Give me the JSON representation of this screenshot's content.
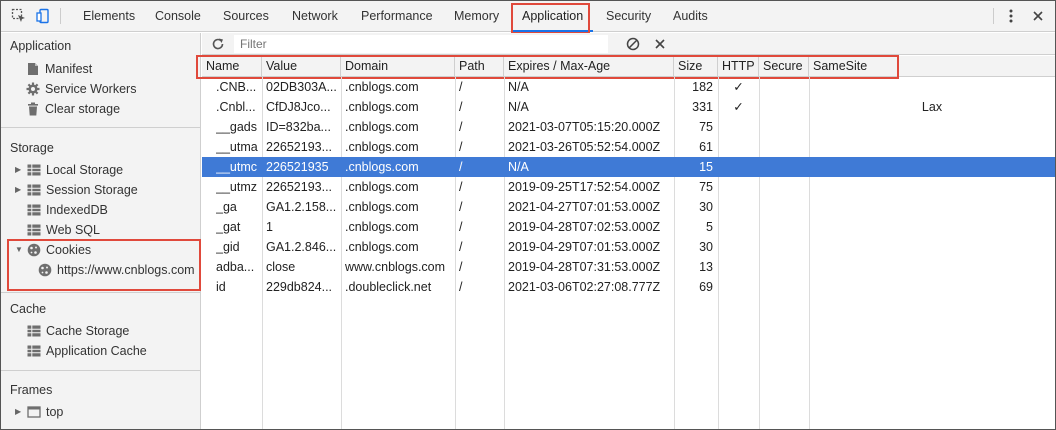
{
  "toolbar": {
    "tabs": [
      "Elements",
      "Console",
      "Sources",
      "Network",
      "Performance",
      "Memory",
      "Application",
      "Security",
      "Audits"
    ],
    "active_tab": "Application"
  },
  "sidebar": {
    "application_title": "Application",
    "application_items": [
      "Manifest",
      "Service Workers",
      "Clear storage"
    ],
    "storage_title": "Storage",
    "storage_items": [
      "Local Storage",
      "Session Storage",
      "IndexedDB",
      "Web SQL",
      "Cookies"
    ],
    "cookie_site": "https://www.cnblogs.com",
    "cache_title": "Cache",
    "cache_items": [
      "Cache Storage",
      "Application Cache"
    ],
    "frames_title": "Frames",
    "frames_items": [
      "top"
    ]
  },
  "filter": {
    "placeholder": "Filter"
  },
  "table": {
    "headers": [
      "Name",
      "Value",
      "Domain",
      "Path",
      "Expires / Max-Age",
      "Size",
      "HTTP",
      "Secure",
      "SameSite"
    ],
    "rows": [
      [
        ".CNB...",
        "02DB303A...",
        ".cnblogs.com",
        "/",
        "N/A",
        "182",
        "✓",
        "",
        ""
      ],
      [
        ".Cnbl...",
        "CfDJ8Jco...",
        ".cnblogs.com",
        "/",
        "N/A",
        "331",
        "✓",
        "",
        "Lax"
      ],
      [
        "__gads",
        "ID=832ba...",
        ".cnblogs.com",
        "/",
        "2021-03-07T05:15:20.000Z",
        "75",
        "",
        "",
        ""
      ],
      [
        "__utma",
        "22652193...",
        ".cnblogs.com",
        "/",
        "2021-03-26T05:52:54.000Z",
        "61",
        "",
        "",
        ""
      ],
      [
        "__utmc",
        "226521935",
        ".cnblogs.com",
        "/",
        "N/A",
        "15",
        "",
        "",
        ""
      ],
      [
        "__utmz",
        "22652193...",
        ".cnblogs.com",
        "/",
        "2019-09-25T17:52:54.000Z",
        "75",
        "",
        "",
        ""
      ],
      [
        "_ga",
        "GA1.2.158...",
        ".cnblogs.com",
        "/",
        "2021-04-27T07:01:53.000Z",
        "30",
        "",
        "",
        ""
      ],
      [
        "_gat",
        "1",
        ".cnblogs.com",
        "/",
        "2019-04-28T07:02:53.000Z",
        "5",
        "",
        "",
        ""
      ],
      [
        "_gid",
        "GA1.2.846...",
        ".cnblogs.com",
        "/",
        "2019-04-29T07:01:53.000Z",
        "30",
        "",
        "",
        ""
      ],
      [
        "adba...",
        "close",
        "www.cnblogs.com",
        "/",
        "2019-04-28T07:31:53.000Z",
        "13",
        "",
        "",
        ""
      ],
      [
        "id",
        "229db824...",
        ".doubleclick.net",
        "/",
        "2021-03-06T02:27:08.777Z",
        "69",
        "",
        "",
        ""
      ]
    ],
    "selected_row": 4
  }
}
